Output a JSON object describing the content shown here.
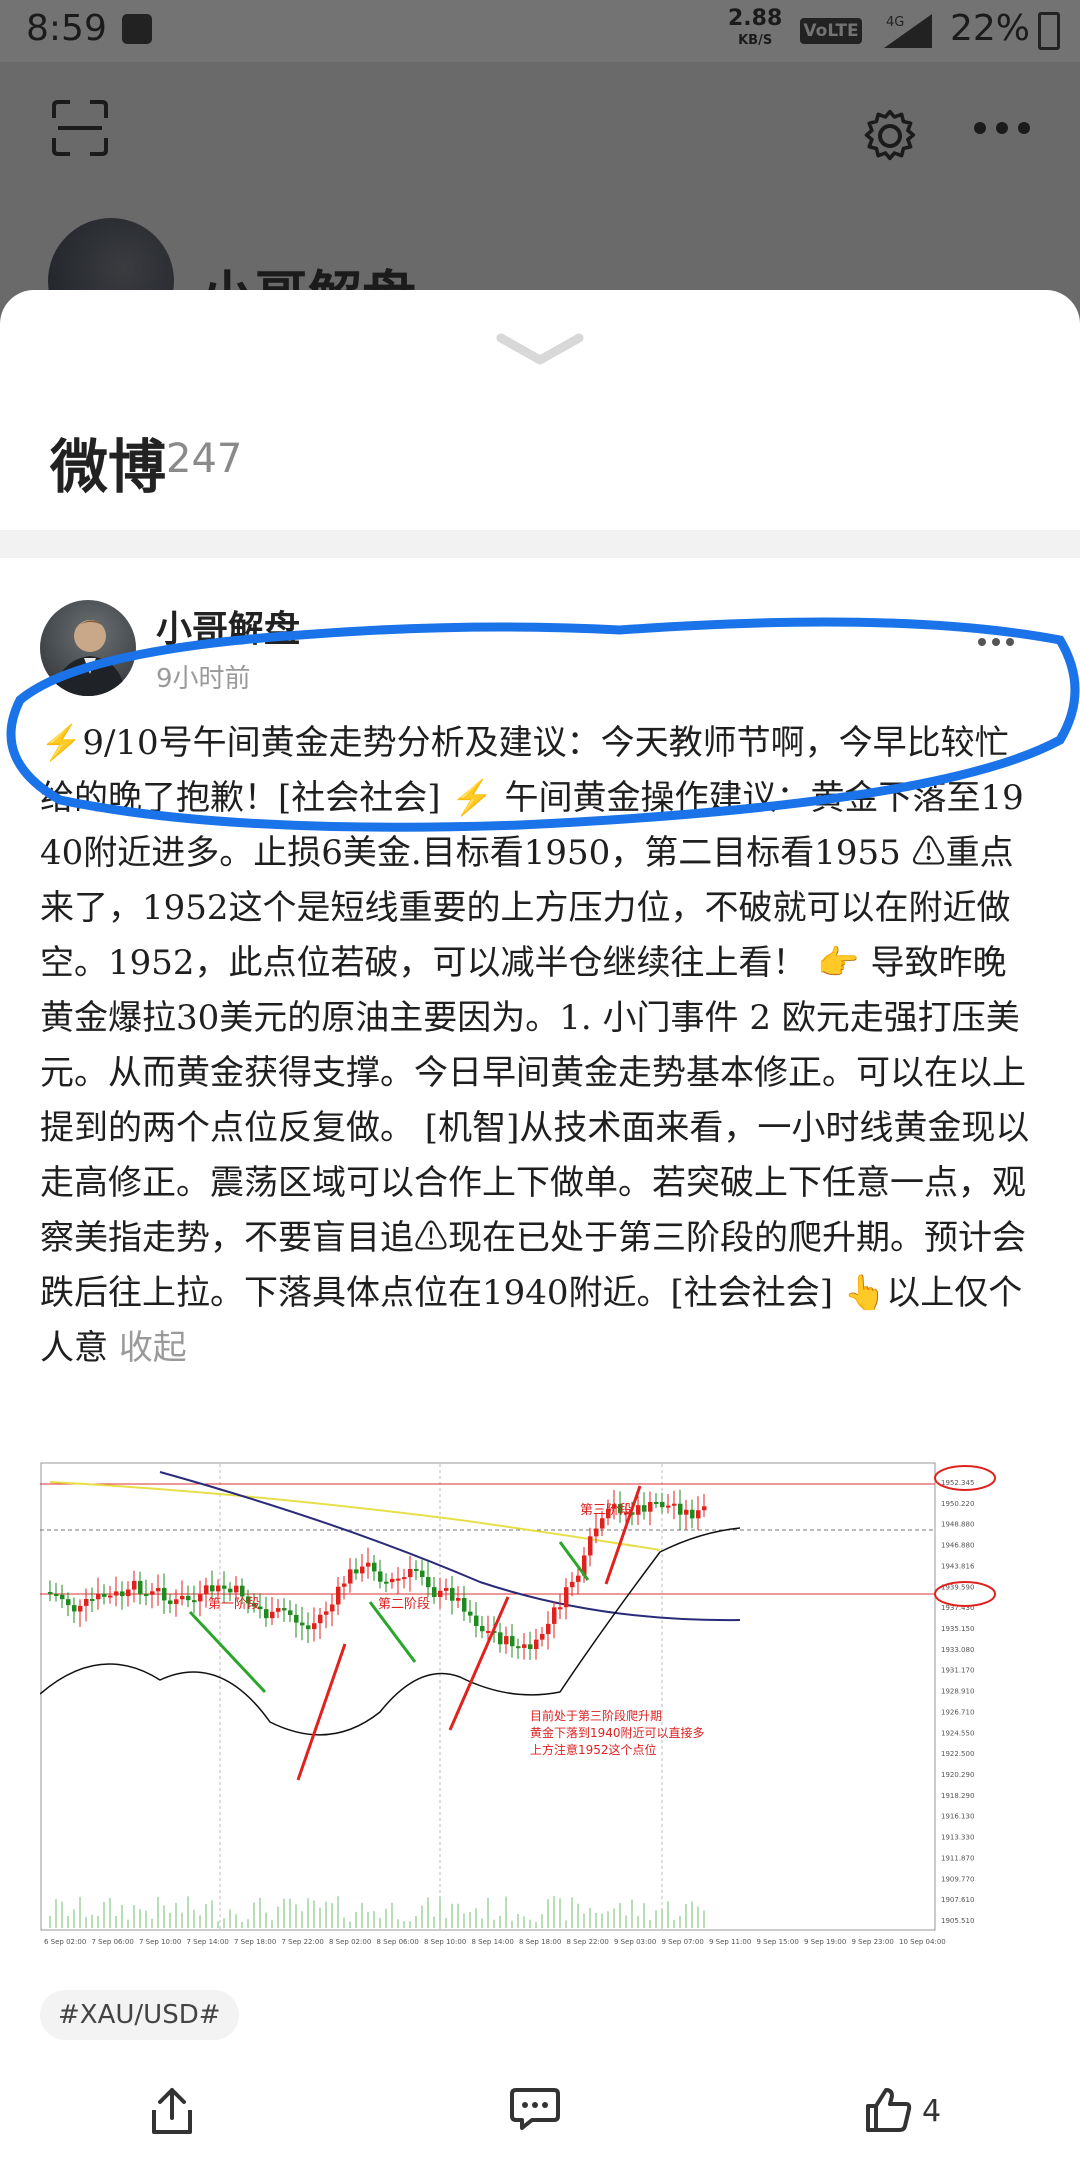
{
  "status_bar": {
    "time": "8:59",
    "net_speed": "2.88",
    "net_unit": "KB/S",
    "volte": "VoLTE",
    "network": "4G",
    "battery": "22%"
  },
  "profile": {
    "name": "小哥解盘"
  },
  "sheet": {
    "title": "微博",
    "count": "247"
  },
  "post": {
    "author": "小哥解盘",
    "time": "9小时前",
    "content": "⚡9/10号午间黄金走势分析及建议：今天教师节啊，今早比较忙给的晚了抱歉！[社会社会] ⚡ 午间黄金操作建议：黄金下落至1940附近进多。止损6美金.目标看1950，第二目标看1955 ⚠重点来了，1952这个是短线重要的上方压力位，不破就可以在附近做空。1952，此点位若破，可以减半仓继续往上看！ 👉 导致昨晚黄金爆拉30美元的原油主要因为。1. 小门事件 2 欧元走强打压美元。从而黄金获得支撑。今日早间黄金走势基本修正。可以在以上提到的两个点位反复做。 [机智]从技术面来看，一小时线黄金现以走高修正。震荡区域可以合作上下做单。若突破上下任意一点，观察美指走势，不要盲目追⚠现在已处于第三阶段的爬升期。预计会跌后往上拉。下落具体点位在1940附近。[社会社会] 👆以上仅个人意",
    "collapse_label": "收起",
    "hashtag": "#XAU/USD#",
    "like_count": "4"
  },
  "chart_image": {
    "stage1_label": "第一阶段",
    "stage2_label": "第二阶段",
    "stage3_label": "第三阶段",
    "note_lines": [
      "目前处于第三阶段爬升期",
      "黄金下落到1940附近可以直接多",
      "上方注意1952这个点位"
    ],
    "price_ticks": [
      "1952.345",
      "1950.220",
      "1948.880",
      "1946.880",
      "1943.816",
      "1939.590",
      "1937.430",
      "1935.150",
      "1933.080",
      "1931.170",
      "1928.910",
      "1926.710",
      "1924.550",
      "1922.500",
      "1920.290",
      "1918.290",
      "1916.130",
      "1913.330",
      "1911.870",
      "1909.770",
      "1907.610",
      "1905.510"
    ],
    "time_ticks": [
      "6 Sep 02:00",
      "7 Sep 06:00",
      "7 Sep 10:00",
      "7 Sep 14:00",
      "7 Sep 18:00",
      "7 Sep 22:00",
      "8 Sep 02:00",
      "8 Sep 06:00",
      "8 Sep 10:00",
      "8 Sep 14:00",
      "8 Sep 18:00",
      "8 Sep 22:00",
      "9 Sep 03:00",
      "9 Sep 07:00",
      "9 Sep 11:00",
      "9 Sep 15:00",
      "9 Sep 19:00",
      "9 Sep 23:00",
      "10 Sep 04:00"
    ],
    "colors": {
      "up": "#e0221e",
      "down": "#1f8a1f",
      "annotation_blue": "#1a73e8",
      "arrow_red": "#e0221e",
      "arrow_green": "#2aa62a"
    }
  }
}
